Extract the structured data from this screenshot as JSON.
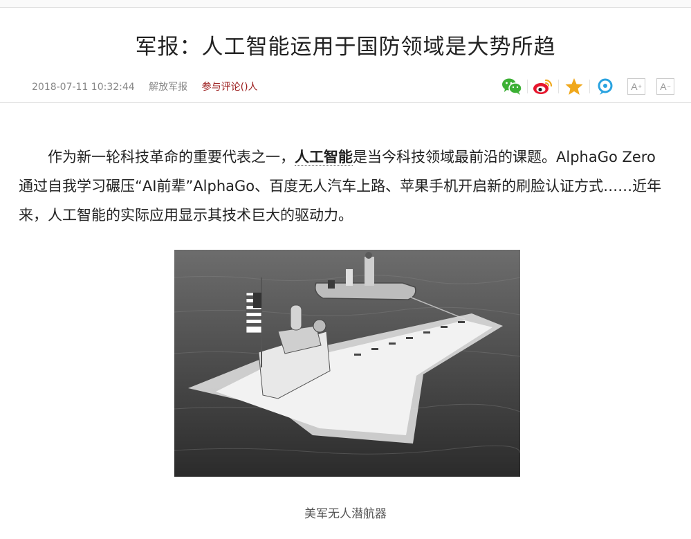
{
  "article": {
    "title": "军报：人工智能运用于国防领域是大势所趋",
    "date": "2018-07-11 10:32:44",
    "source": "解放军报",
    "comment_link": "参与评论()人",
    "paragraph_start": "作为新一轮科技革命的重要代表之一，",
    "keyword": "人工智能",
    "paragraph_rest": "是当今科技领域最前沿的课题。AlphaGo Zero通过自我学习碾压“AI前辈”AlphaGo、百度无人汽车上路、苹果手机开启新的刷脸认证方式……近年来，人工智能的实际应用显示其技术巨大的驱动力。",
    "image_caption": "美军无人潜航器"
  },
  "share": {
    "buttons": [
      "wechat-icon",
      "weibo-icon",
      "favorite-star-icon",
      "qzone-icon"
    ],
    "font_increase": "A",
    "font_decrease": "A",
    "colors": {
      "wechat": "#3cb034",
      "weibo": "#e6162d",
      "star": "#f0a81c",
      "qzone": "#2aa3e0"
    }
  }
}
